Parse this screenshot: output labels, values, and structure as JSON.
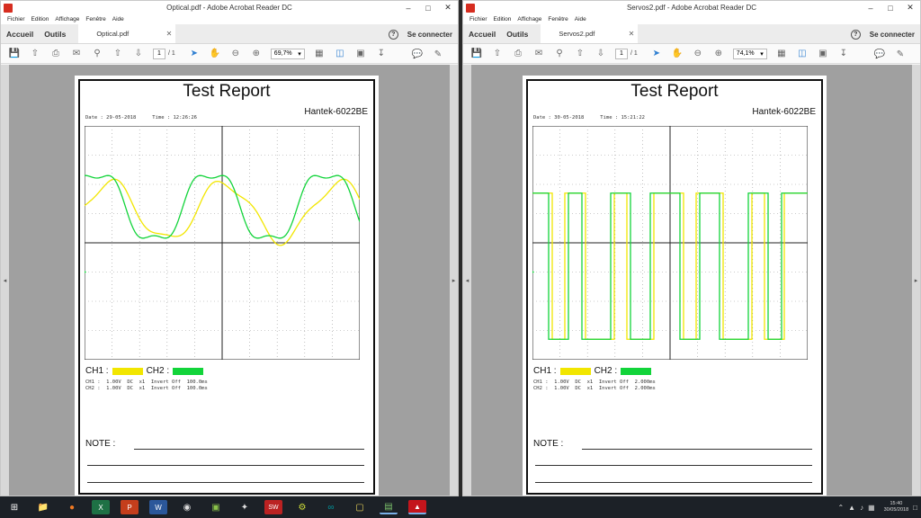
{
  "menu": [
    "Fichier",
    "Edition",
    "Affichage",
    "Fenêtre",
    "Aide"
  ],
  "tabs": {
    "home": "Accueil",
    "tools": "Outils",
    "connect": "Se connecter"
  },
  "windows": [
    {
      "title": "Optical.pdf - Adobe Acrobat Reader DC",
      "tab_name": "Optical.pdf",
      "page_current": "1",
      "page_total": "/ 1",
      "zoom": "69,7%",
      "report": {
        "title": "Test Report",
        "model": "Hantek-6022BE",
        "date": "Date : 29-05-2018",
        "time": "Time : 12:26:26",
        "ch1_label": "CH1 :",
        "ch2_label": "CH2 :",
        "ch1_info": "CH1 :  1.00V  DC  x1  Invert Off  100.0ms",
        "ch2_info": "CH2 :  1.00V  DC  x1  Invert Off  100.0ms",
        "note_label": "NOTE :"
      },
      "waveform": "sine"
    },
    {
      "title": "Servos2.pdf - Adobe Acrobat Reader DC",
      "tab_name": "Servos2.pdf",
      "page_current": "1",
      "page_total": "/ 1",
      "zoom": "74,1%",
      "report": {
        "title": "Test Report",
        "model": "Hantek-6022BE",
        "date": "Date : 30-05-2018",
        "time": "Time : 15:21:22",
        "ch1_label": "CH1 :",
        "ch2_label": "CH2 :",
        "ch1_info": "CH1 :  1.00V  DC  x1  Invert Off  2.000ms",
        "ch2_info": "CH2 :  1.00V  DC  x1  Invert Off  2.000ms",
        "note_label": "NOTE :"
      },
      "waveform": "square"
    }
  ],
  "colors": {
    "ch1": "#f2e600",
    "ch2": "#12d43a"
  },
  "clock": {
    "time": "15:40",
    "date": "30/05/2018"
  }
}
